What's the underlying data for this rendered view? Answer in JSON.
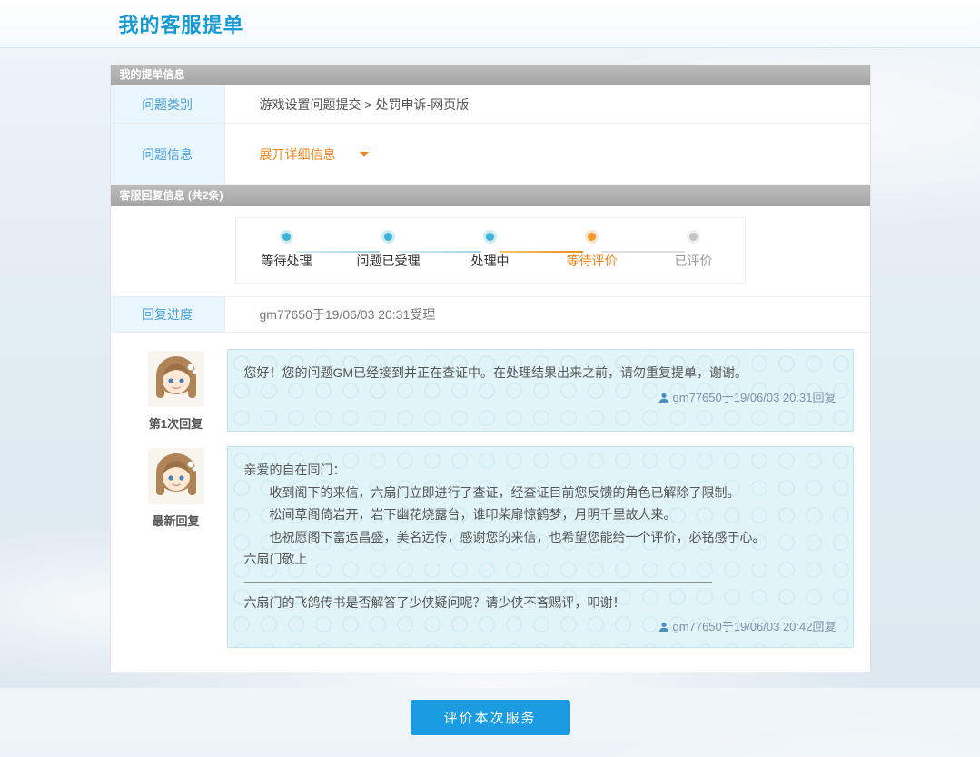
{
  "colors": {
    "accent_blue": "#189ad5",
    "label_blue": "#4a9fd4",
    "orange": "#f08519",
    "bubble_background": "#e1f4f8",
    "button_blue": "#1b9be2",
    "section_bar_gray": "#adadad"
  },
  "header": {
    "title": "我的客服提单"
  },
  "ticket": {
    "section_title": "我的提单信息",
    "category_label": "问题类别",
    "category_value": "游戏设置问题提交 > 处罚申诉-网页版",
    "info_label": "问题信息",
    "expand_link": "展开详细信息"
  },
  "reply": {
    "section_title": "客服回复信息 (共2条)",
    "steps": [
      {
        "label": "等待处理",
        "state": "done"
      },
      {
        "label": "问题已受理",
        "state": "done"
      },
      {
        "label": "处理中",
        "state": "done"
      },
      {
        "label": "等待评价",
        "state": "current"
      },
      {
        "label": "已评价",
        "state": "pending"
      }
    ],
    "progress_label": "回复进度",
    "progress_value": "gm77650于19/06/03 20:31受理",
    "reply1": {
      "label": "第1次回复",
      "text": "您好！您的问题GM已经接到并正在查证中。在处理结果出来之前，请勿重复提单，谢谢。",
      "signature": "gm77650于19/06/03 20:31回复"
    },
    "reply2": {
      "label": "最新回复",
      "line1": "亲爱的自在同门：",
      "line2": "收到阁下的来信，六扇门立即进行了查证，经查证目前您反馈的角色已解除了限制。",
      "line3": "松间草阁倚岩开，岩下幽花烧露台，谁叩柴扉惊鹤梦，月明千里故人来。",
      "line4": "也祝愿阁下富运昌盛，美名远传，感谢您的来信，也希望您能给一个评价，必铭感于心。",
      "line5": "六扇门敬上",
      "question": "六扇门的飞鸽传书是否解答了少侠疑问呢？请少侠不吝赐评，叩谢！",
      "signature": "gm77650于19/06/03 20:42回复"
    }
  },
  "footer": {
    "evaluate_button": "评价本次服务"
  }
}
